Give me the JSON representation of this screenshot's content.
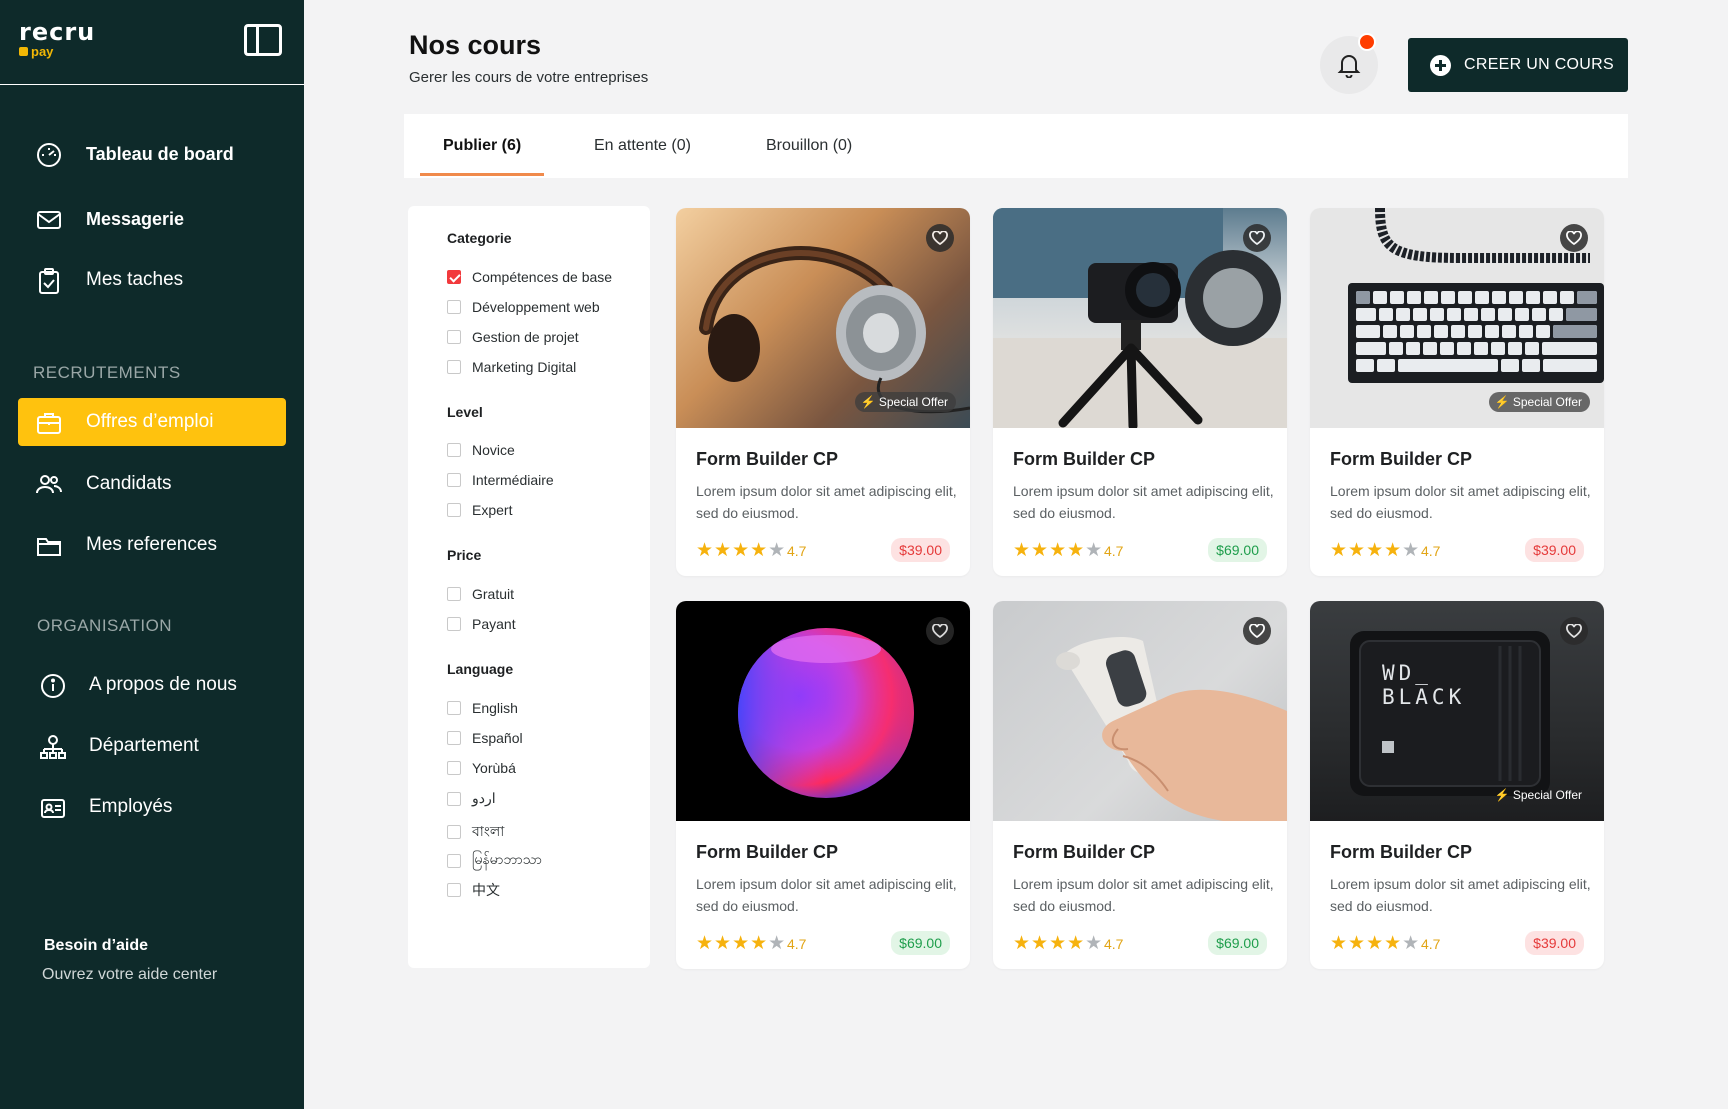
{
  "brand": {
    "logo_main": "recru",
    "logo_sub": "pay"
  },
  "sidebar": {
    "items": [
      {
        "label": "Tableau de board",
        "icon": "dashboard-gauge-icon"
      },
      {
        "label": "Messagerie",
        "icon": "mail-icon"
      },
      {
        "label": "Mes taches",
        "icon": "clipboard-check-icon"
      }
    ],
    "section_recrutements": "RECRUTEMENTS",
    "recrutements": [
      {
        "label": "Offres d’emploi",
        "icon": "briefcase-icon",
        "active": true
      },
      {
        "label": "Candidats",
        "icon": "users-icon"
      },
      {
        "label": "Mes references",
        "icon": "folder-icon"
      }
    ],
    "section_organisation": "ORGANISATION",
    "organisation": [
      {
        "label": "A propos de nous",
        "icon": "info-icon"
      },
      {
        "label": "Département",
        "icon": "org-chart-icon"
      },
      {
        "label": "Employés",
        "icon": "id-card-icon"
      }
    ],
    "help_title": "Besoin d’aide",
    "help_sub": "Ouvrez votre aide center"
  },
  "header": {
    "title": "Nos cours",
    "subtitle": "Gerer les cours de votre entreprises",
    "create_button": "CREER UN COURS",
    "accent_color": "#0e2a2a",
    "notification_color": "#ff3d00"
  },
  "tabs": [
    {
      "label": "Publier (6)",
      "active": true
    },
    {
      "label": "En attente (0)"
    },
    {
      "label": "Brouillon (0)"
    }
  ],
  "filters": {
    "categorie": {
      "title": "Categorie",
      "options": [
        "Compétences de base",
        "Développement web",
        "Gestion de projet",
        "Marketing Digital"
      ],
      "checked": "Compétences de base"
    },
    "level": {
      "title": "Level",
      "options": [
        "Novice",
        "Intermédiaire",
        "Expert"
      ]
    },
    "price": {
      "title": "Price",
      "options": [
        "Gratuit",
        "Payant"
      ]
    },
    "language": {
      "title": "Language",
      "options": [
        "English",
        "Español",
        "Yorùbá",
        "اردو",
        "বাংলা",
        "မြန်မာဘာသာ",
        "中文"
      ]
    }
  },
  "cards": [
    {
      "title": "Form Builder CP",
      "desc": "Lorem ipsum dolor sit amet adipiscing elit, sed do eiusmod.",
      "rating": "4.7",
      "stars": 4,
      "price": "$39.00",
      "price_tone": "red",
      "offer": "Special Offer",
      "image": "headphones"
    },
    {
      "title": "Form Builder CP",
      "desc": "Lorem ipsum dolor sit amet adipiscing elit, sed do eiusmod.",
      "rating": "4.7",
      "stars": 4,
      "price": "$69.00",
      "price_tone": "green",
      "offer": "",
      "image": "camera-tripod"
    },
    {
      "title": "Form Builder CP",
      "desc": "Lorem ipsum dolor sit amet adipiscing elit, sed do eiusmod.",
      "rating": "4.7",
      "stars": 4,
      "price": "$39.00",
      "price_tone": "red",
      "offer": "Special Offer",
      "image": "keyboard"
    },
    {
      "title": "Form Builder CP",
      "desc": "Lorem ipsum dolor sit amet adipiscing elit, sed do eiusmod.",
      "rating": "4.7",
      "stars": 4,
      "price": "$69.00",
      "price_tone": "green",
      "offer": "",
      "image": "smart-speaker"
    },
    {
      "title": "Form Builder CP",
      "desc": "Lorem ipsum dolor sit amet adipiscing elit, sed do eiusmod.",
      "rating": "4.7",
      "stars": 4,
      "price": "$69.00",
      "price_tone": "green",
      "offer": "",
      "image": "thermometer"
    },
    {
      "title": "Form Builder CP",
      "desc": "Lorem ipsum dolor sit amet adipiscing elit, sed do eiusmod.",
      "rating": "4.7",
      "stars": 4,
      "price": "$39.00",
      "price_tone": "red",
      "offer": "Special Offer",
      "image": "hard-drive",
      "image_text": "WD_ BLACK"
    }
  ]
}
